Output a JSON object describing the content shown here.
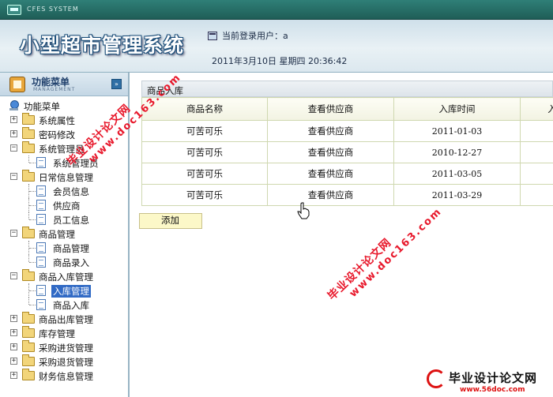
{
  "window": {
    "system_name": "CFES SYSTEM"
  },
  "header": {
    "app_title": "小型超市管理系统",
    "current_user": "当前登录用户：a",
    "datetime": "2011年3月10日  星期四  20:36:42"
  },
  "sidebar": {
    "title": "功能菜单",
    "subtitle": "MANAGEMENT",
    "collapse_glyph": "»",
    "root_label": "功能菜单",
    "items": [
      {
        "label": "系统属性",
        "expanded": false
      },
      {
        "label": "密码修改",
        "expanded": false
      },
      {
        "label": "系统管理员",
        "expanded": true,
        "children": [
          "系统管理员"
        ]
      },
      {
        "label": "日常信息管理",
        "expanded": true,
        "children": [
          "会员信息",
          "供应商",
          "员工信息"
        ]
      },
      {
        "label": "商品管理",
        "expanded": true,
        "children": [
          "商品管理",
          "商品录入"
        ]
      },
      {
        "label": "商品入库管理",
        "expanded": true,
        "children": [
          "入库管理",
          "商品入库"
        ],
        "selected_child": "入库管理"
      },
      {
        "label": "商品出库管理",
        "expanded": false
      },
      {
        "label": "库存管理",
        "expanded": false
      },
      {
        "label": "采购进货管理",
        "expanded": false
      },
      {
        "label": "采购退货管理",
        "expanded": false
      },
      {
        "label": "财务信息管理",
        "expanded": false
      }
    ]
  },
  "main": {
    "panel_title": "商品入库",
    "table": {
      "columns": [
        "商品名称",
        "查看供应商",
        "入库时间",
        "入"
      ],
      "rows": [
        [
          "可苦可乐",
          "查看供应商",
          "2011-01-03",
          ""
        ],
        [
          "可苦可乐",
          "查看供应商",
          "2010-12-27",
          ""
        ],
        [
          "可苦可乐",
          "查看供应商",
          "2011-03-05",
          ""
        ],
        [
          "可苦可乐",
          "查看供应商",
          "2011-03-29",
          ""
        ]
      ]
    },
    "add_button": "添加"
  },
  "watermarks": [
    {
      "line1": "毕业设计论文网",
      "line2": "www.doc163.com"
    },
    {
      "line1": "毕业设计论文网",
      "line2": "www.doc163.com"
    }
  ],
  "logo": {
    "text": "毕业设计论文网",
    "url": "www.56doc.com"
  },
  "colors": {
    "titlebar": "#2f7f77",
    "selection": "#316ac5",
    "watermark": "#e8192c",
    "button": "#fcf8c8"
  }
}
